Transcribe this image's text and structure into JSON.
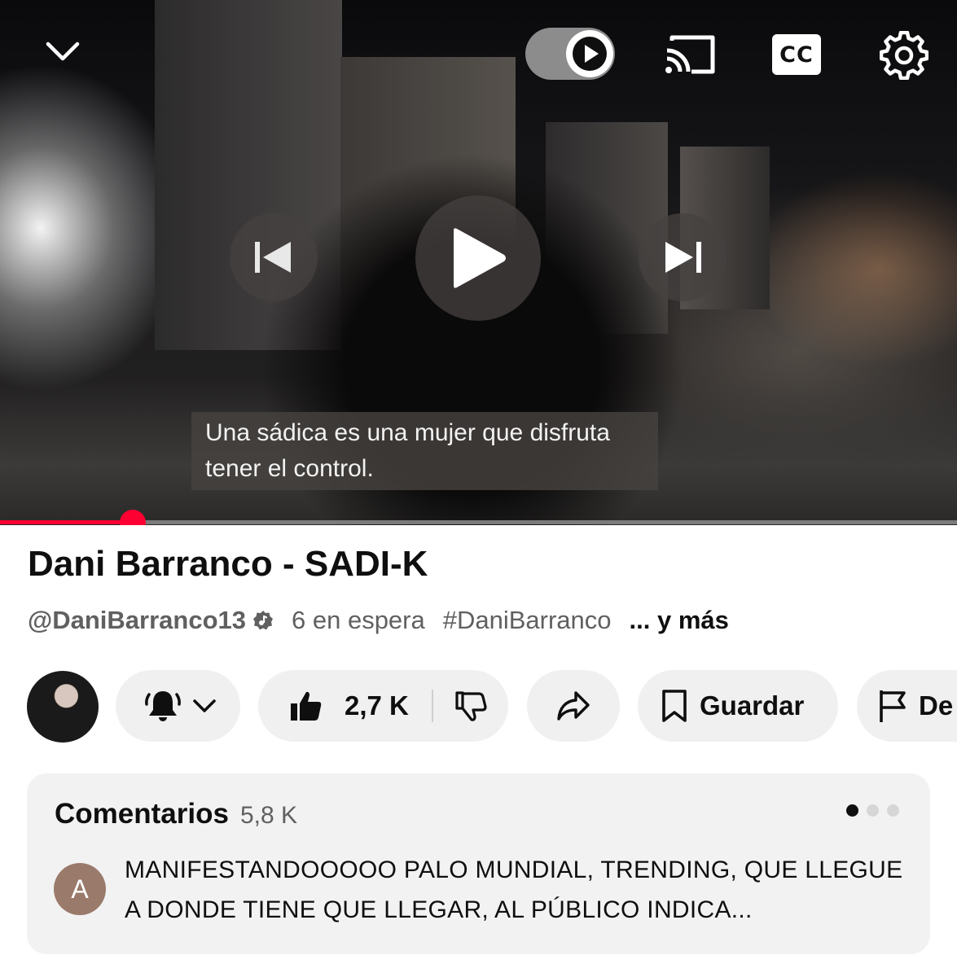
{
  "player": {
    "caption_line1": "Una sádica es una mujer que disfruta",
    "caption_line2": "tener el control.",
    "cc_label": "CC",
    "progress_fraction": 0.139,
    "accent_color": "#ff0033"
  },
  "video": {
    "title": "Dani Barranco - SADI-K",
    "channel_handle": "@DaniBarranco13",
    "queue_text": "6 en espera",
    "hashtag": "#DaniBarranco",
    "more_text": "... y más"
  },
  "actions": {
    "like_count": "2,7 K",
    "save_label": "Guardar",
    "report_label": "De"
  },
  "comments": {
    "heading": "Comentarios",
    "count": "5,8 K",
    "top_comment": {
      "avatar_letter": "A",
      "text": "MANIFESTANDOOOOO PALO MUNDIAL, TRENDING, QUE LLEGUE A DONDE TIENE QUE LLEGAR, AL PÚBLICO INDICA..."
    },
    "pager_dots": 3,
    "pager_active": 1
  },
  "icons": [
    "chevron-down-icon",
    "autoplay-toggle",
    "cast-icon",
    "cc-icon",
    "gear-icon",
    "previous-icon",
    "play-icon",
    "next-icon",
    "verified-music-icon",
    "bell-icon",
    "thumbs-up-icon",
    "thumbs-down-icon",
    "share-icon",
    "bookmark-icon",
    "flag-icon"
  ]
}
